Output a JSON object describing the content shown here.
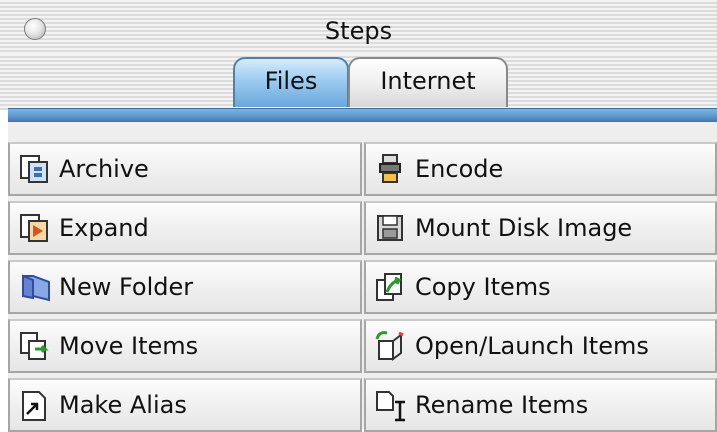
{
  "window": {
    "title": "Steps"
  },
  "tabs": [
    {
      "label": "Files",
      "selected": true
    },
    {
      "label": "Internet",
      "selected": false
    }
  ],
  "steps": {
    "left": [
      {
        "label": "Archive",
        "icon": "archive-icon"
      },
      {
        "label": "Expand",
        "icon": "expand-icon"
      },
      {
        "label": "New Folder",
        "icon": "folder-icon"
      },
      {
        "label": "Move Items",
        "icon": "move-items-icon"
      },
      {
        "label": "Make Alias",
        "icon": "alias-icon"
      }
    ],
    "right": [
      {
        "label": "Encode",
        "icon": "encode-icon"
      },
      {
        "label": "Mount Disk Image",
        "icon": "disk-image-icon"
      },
      {
        "label": "Copy Items",
        "icon": "copy-items-icon"
      },
      {
        "label": "Open/Launch Items",
        "icon": "open-launch-icon"
      },
      {
        "label": "Rename Items",
        "icon": "rename-icon"
      }
    ]
  },
  "colors": {
    "selected_tab": "#6aa7db",
    "tab_bar": "#5b94cd"
  }
}
